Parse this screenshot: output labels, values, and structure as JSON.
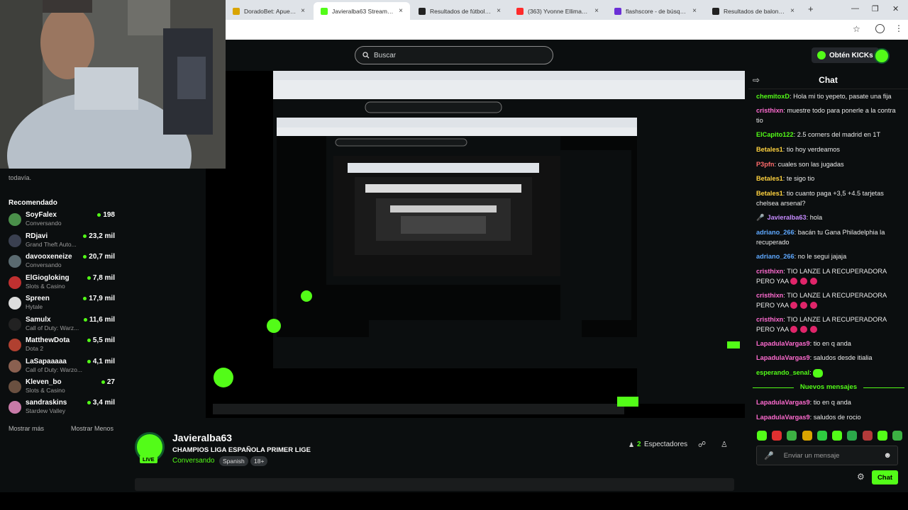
{
  "browser": {
    "tabs": [
      {
        "label": "DoradoBet: Apuestas y Ca",
        "color": "#d9a400",
        "active": false
      },
      {
        "label": "Javieralba63 Stream - Wa",
        "color": "#53fc18",
        "active": true
      },
      {
        "label": "Resultados de fútbol en v",
        "color": "#222222",
        "active": false
      },
      {
        "label": "(363) Yvonne Elliman - If",
        "color": "#ff2b2b",
        "active": false
      },
      {
        "label": "flashscore - de búsqueda",
        "color": "#6b2fd6",
        "active": false
      },
      {
        "label": "Resultados de baloncesto",
        "color": "#222222",
        "active": false
      }
    ],
    "new_tab": "+",
    "close": "×"
  },
  "header": {
    "search_placeholder": "Buscar",
    "kicks_label": "Obtén KICKs"
  },
  "sidebar": {
    "note": "todavía.",
    "recommended_title": "Recomendado",
    "items": [
      {
        "name": "SoyFalex",
        "category": "Conversando",
        "viewers": "198",
        "color": "#4a8f4a"
      },
      {
        "name": "RDjavi",
        "category": "Grand Theft Auto...",
        "viewers": "23,2 mil",
        "color": "#3a4050"
      },
      {
        "name": "davooxeneize",
        "category": "Conversando",
        "viewers": "20,7 mil",
        "color": "#5a6a70"
      },
      {
        "name": "ElGiogloking",
        "category": "Slots & Casino",
        "viewers": "7,8 mil",
        "color": "#c03030"
      },
      {
        "name": "Spreen",
        "category": "Hytale",
        "viewers": "17,9 mil",
        "color": "#dddddd"
      },
      {
        "name": "Samulx",
        "category": "Call of Duty: Warz...",
        "viewers": "11,6 mil",
        "color": "#222222"
      },
      {
        "name": "MatthewDota",
        "category": "Dota 2",
        "viewers": "5,5 mil",
        "color": "#b04030"
      },
      {
        "name": "LaSapaaaaa",
        "category": "Call of Duty: Warzo...",
        "viewers": "4,1 mil",
        "color": "#8a6050"
      },
      {
        "name": "Kleven_bo",
        "category": "Slots & Casino",
        "viewers": "27",
        "color": "#6a5040"
      },
      {
        "name": "sandraskins",
        "category": "Stardew Valley",
        "viewers": "3,4 mil",
        "color": "#c87aa8"
      }
    ],
    "show_more": "Mostrar más",
    "show_less": "Mostrar Menos"
  },
  "channel": {
    "name": "Javieralba63",
    "title": "CHAMPIOS LIGA ESPAÑOLA PRIMER LIGE",
    "category": "Conversando",
    "tags": [
      "Spanish",
      "18+"
    ],
    "live_badge": "LIVE",
    "viewers_count": "2",
    "viewers_label": "Espectadores"
  },
  "chat": {
    "title": "Chat",
    "messages": [
      {
        "user": "chemitoxD",
        "color": "#53fc18",
        "text": "Hola mi tio yepeto, pasate una fija"
      },
      {
        "user": "cristhixn",
        "color": "#ff6bd0",
        "text": "muestre todo para ponerle a la contra tio"
      },
      {
        "user": "ElCapito122",
        "color": "#53fc18",
        "text": "2.5 corners del madrid en 1T"
      },
      {
        "user": "Betales1",
        "color": "#ffd23f",
        "text": "tio hoy verdeamos"
      },
      {
        "user": "P3pfn",
        "color": "#ff6b6b",
        "text": "cuales son las jugadas"
      },
      {
        "user": "Betales1",
        "color": "#ffd23f",
        "text": "te sigo tio"
      },
      {
        "user": "Betales1",
        "color": "#ffd23f",
        "text": "tio cuanto paga +3,5 +4.5 tarjetas chelsea arsenal?"
      },
      {
        "user": "Javieralba63",
        "color": "#c68cff",
        "text": "hola"
      },
      {
        "user": "adriano_266",
        "color": "#5ea8ff",
        "text": "bacán tu Gana Philadelphia la recuperado"
      },
      {
        "user": "adriano_266",
        "color": "#5ea8ff",
        "text": "no le segui jajaja"
      },
      {
        "user": "cristhixn",
        "color": "#ff6bd0",
        "text": "TIO LANZE LA RECUPERADORA PERO YAA"
      },
      {
        "user": "cristhixn",
        "color": "#ff6bd0",
        "text": "TIO LANZE LA RECUPERADORA PERO YAA"
      },
      {
        "user": "cristhixn",
        "color": "#ff6bd0",
        "text": "TIO LANZE LA RECUPERADORA PERO YAA"
      },
      {
        "user": "LapadulaVargas9",
        "color": "#ff6bd0",
        "text": "tio en q anda"
      },
      {
        "user": "LapadulaVargas9",
        "color": "#ff6bd0",
        "text": "saludos desde itialia"
      },
      {
        "user": "esperando_senal",
        "color": "#53fc18",
        "text": ""
      }
    ],
    "new_messages_label": "Nuevos mensajes",
    "new_messages": [
      {
        "user": "LapadulaVargas9",
        "color": "#ff6bd0",
        "text": "tio en q anda"
      },
      {
        "user": "LapadulaVargas9",
        "color": "#ff6bd0",
        "text": "saludos de rocio"
      }
    ],
    "input_placeholder": "Enviar un mensaje",
    "send_label": "Chat"
  }
}
